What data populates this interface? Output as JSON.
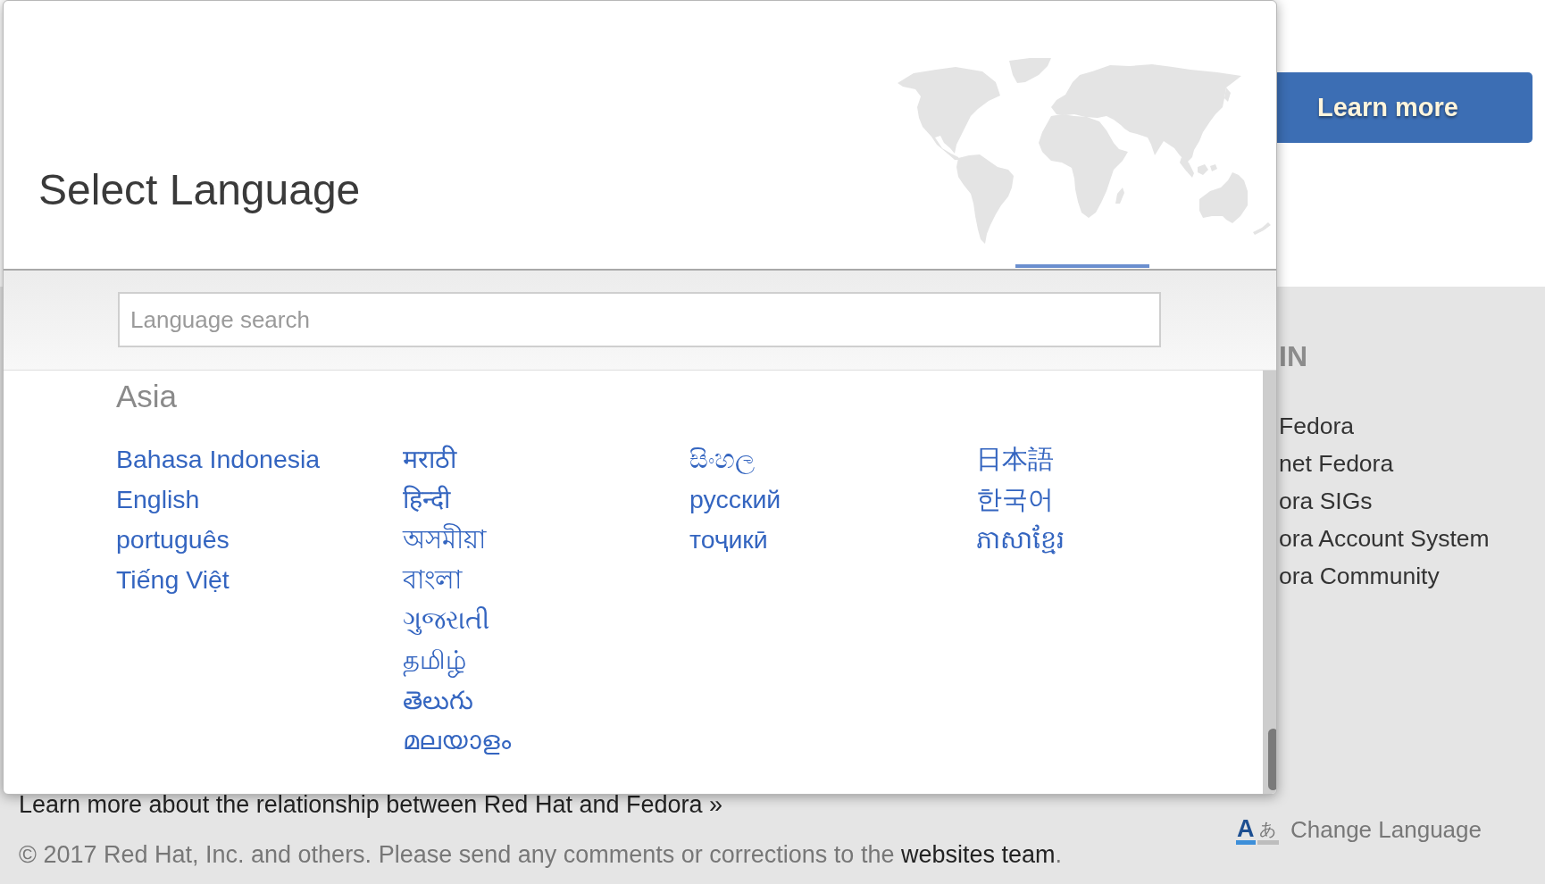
{
  "language_dialog": {
    "title": "Select Language",
    "search": {
      "placeholder": "Language search"
    },
    "region": "Asia",
    "language_columns": [
      [
        "Bahasa Indonesia",
        "English",
        "português",
        "Tiếng Việt"
      ],
      [
        "मराठी",
        "हिन्दी",
        "অসমীয়া",
        "বাংলা",
        "ગુજરાતી",
        "தமிழ்",
        "తెలుగు",
        "മലയാളം"
      ],
      [
        "සිංහල",
        "русский",
        "тоҷикӣ"
      ],
      [
        "日本語",
        "한국어",
        "ភាសាខ្មែរ"
      ]
    ]
  },
  "background_page": {
    "banner_button": "Learn more",
    "sidebar": {
      "heading": "IN",
      "links": [
        "Fedora",
        "net Fedora",
        "ora SIGs",
        "ora Account System",
        "ora Community"
      ]
    },
    "footer": {
      "relationship_link": "Learn more about the relationship between Red Hat and Fedora »",
      "copyright": {
        "text": "© 2017 Red Hat, Inc. and others. Please send any comments or corrections to the ",
        "link": "websites team",
        "end": "."
      },
      "change_language": {
        "icon_glyphs": [
          "A",
          "あ"
        ],
        "label": "Change Language"
      }
    }
  }
}
